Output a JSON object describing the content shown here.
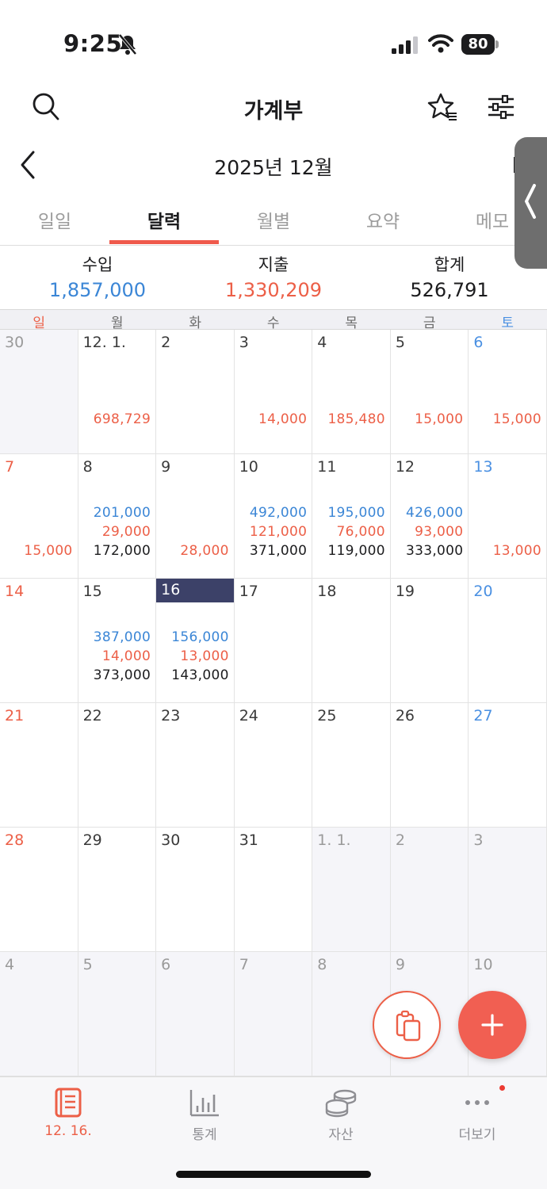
{
  "status_bar": {
    "time": "9:25",
    "battery": "80"
  },
  "header": {
    "title": "가계부"
  },
  "month_nav": {
    "title": "2025년 12월"
  },
  "tabs": [
    {
      "label": "일일",
      "active": false
    },
    {
      "label": "달력",
      "active": true
    },
    {
      "label": "월별",
      "active": false
    },
    {
      "label": "요약",
      "active": false
    },
    {
      "label": "메모",
      "active": false
    }
  ],
  "summary": {
    "income_label": "수입",
    "income_value": "1,857,000",
    "expense_label": "지출",
    "expense_value": "1,330,209",
    "total_label": "합계",
    "total_value": "526,791"
  },
  "weekdays": [
    "일",
    "월",
    "화",
    "수",
    "목",
    "금",
    "토"
  ],
  "calendar": {
    "weeks": [
      [
        {
          "day": "30",
          "muted": true
        },
        {
          "day": "12. 1.",
          "expense": "698,729"
        },
        {
          "day": "2"
        },
        {
          "day": "3",
          "expense": "14,000"
        },
        {
          "day": "4",
          "expense": "185,480"
        },
        {
          "day": "5",
          "expense": "15,000"
        },
        {
          "day": "6",
          "expense": "15,000"
        }
      ],
      [
        {
          "day": "7",
          "expense": "15,000"
        },
        {
          "day": "8",
          "income": "201,000",
          "expense": "29,000",
          "total": "172,000"
        },
        {
          "day": "9",
          "expense": "28,000"
        },
        {
          "day": "10",
          "income": "492,000",
          "expense": "121,000",
          "total": "371,000"
        },
        {
          "day": "11",
          "income": "195,000",
          "expense": "76,000",
          "total": "119,000"
        },
        {
          "day": "12",
          "income": "426,000",
          "expense": "93,000",
          "total": "333,000"
        },
        {
          "day": "13",
          "expense": "13,000"
        }
      ],
      [
        {
          "day": "14"
        },
        {
          "day": "15",
          "income": "387,000",
          "expense": "14,000",
          "total": "373,000"
        },
        {
          "day": "16",
          "today": true,
          "income": "156,000",
          "expense": "13,000",
          "total": "143,000"
        },
        {
          "day": "17"
        },
        {
          "day": "18"
        },
        {
          "day": "19"
        },
        {
          "day": "20"
        }
      ],
      [
        {
          "day": "21"
        },
        {
          "day": "22"
        },
        {
          "day": "23"
        },
        {
          "day": "24"
        },
        {
          "day": "25"
        },
        {
          "day": "26"
        },
        {
          "day": "27"
        }
      ],
      [
        {
          "day": "28"
        },
        {
          "day": "29"
        },
        {
          "day": "30"
        },
        {
          "day": "31"
        },
        {
          "day": "1. 1.",
          "muted": true
        },
        {
          "day": "2",
          "muted": true
        },
        {
          "day": "3",
          "muted": true
        }
      ],
      [
        {
          "day": "4",
          "muted": true
        },
        {
          "day": "5",
          "muted": true
        },
        {
          "day": "6",
          "muted": true
        },
        {
          "day": "7",
          "muted": true
        },
        {
          "day": "8",
          "muted": true
        },
        {
          "day": "9",
          "muted": true
        },
        {
          "day": "10",
          "muted": true
        }
      ]
    ]
  },
  "bottom_nav": [
    {
      "label": "12. 16.",
      "icon": "ledger-book-icon",
      "active": true
    },
    {
      "label": "통계",
      "icon": "bar-chart-icon",
      "active": false
    },
    {
      "label": "자산",
      "icon": "coins-stack-icon",
      "active": false
    },
    {
      "label": "더보기",
      "icon": "more-dots-icon",
      "active": false
    }
  ],
  "colors": {
    "accent": "#ef5a4c",
    "income": "#3b86d6",
    "expense": "#ec5f47",
    "today": "#3c4168"
  }
}
